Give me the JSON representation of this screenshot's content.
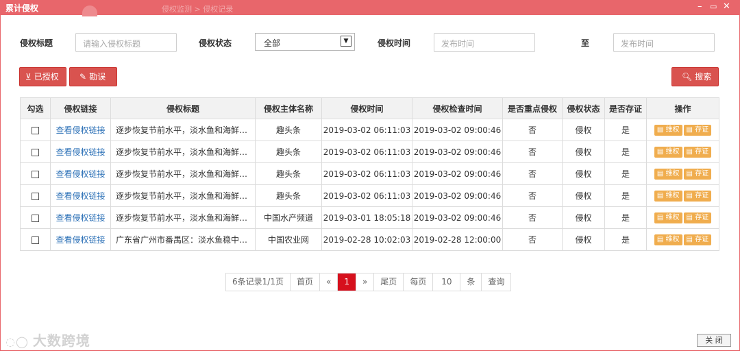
{
  "window": {
    "title": "累计侵权",
    "background_crumb": "侵权监测 > 侵权记录",
    "controls": {
      "minimize": "–",
      "maximize": "▭",
      "close": "✕"
    }
  },
  "filters": {
    "title_label": "侵权标题",
    "title_placeholder": "请输入侵权标题",
    "status_label": "侵权状态",
    "status_value": "全部",
    "time_label": "侵权时间",
    "time_from_placeholder": "发布时间",
    "to_label": "至",
    "time_to_placeholder": "发布时间"
  },
  "actions": {
    "authorized": "已授权",
    "misreport": "勘误",
    "search": "搜索"
  },
  "table": {
    "headers": [
      "勾选",
      "侵权链接",
      "侵权标题",
      "侵权主体名称",
      "侵权时间",
      "侵权检查时间",
      "是否重点侵权",
      "侵权状态",
      "是否存证",
      "操作"
    ],
    "rows": [
      {
        "link": "查看侵权链接",
        "title": "逐步恢复节前水平，淡水鱼和海鲜稳...",
        "subject": "趣头条",
        "time": "2019-03-02 06:11:03",
        "check_time": "2019-03-02 09:00:46",
        "key": "否",
        "status": "侵权",
        "evidence": "是"
      },
      {
        "link": "查看侵权链接",
        "title": "逐步恢复节前水平，淡水鱼和海鲜稳...",
        "subject": "趣头条",
        "time": "2019-03-02 06:11:03",
        "check_time": "2019-03-02 09:00:46",
        "key": "否",
        "status": "侵权",
        "evidence": "是"
      },
      {
        "link": "查看侵权链接",
        "title": "逐步恢复节前水平，淡水鱼和海鲜稳...",
        "subject": "趣头条",
        "time": "2019-03-02 06:11:03",
        "check_time": "2019-03-02 09:00:46",
        "key": "否",
        "status": "侵权",
        "evidence": "是"
      },
      {
        "link": "查看侵权链接",
        "title": "逐步恢复节前水平，淡水鱼和海鲜稳...",
        "subject": "趣头条",
        "time": "2019-03-02 06:11:03",
        "check_time": "2019-03-02 09:00:46",
        "key": "否",
        "status": "侵权",
        "evidence": "是"
      },
      {
        "link": "查看侵权链接",
        "title": "逐步恢复节前水平，淡水鱼和海鲜稳...",
        "subject": "中国水产频道",
        "time": "2019-03-01 18:05:18",
        "check_time": "2019-03-02 09:00:46",
        "key": "否",
        "status": "侵权",
        "evidence": "是"
      },
      {
        "link": "查看侵权链接",
        "title": "广东省广州市番禺区：淡水鱼稳中有...",
        "subject": "中国农业网",
        "time": "2019-02-28 10:02:03",
        "check_time": "2019-02-28 12:00:00",
        "key": "否",
        "status": "侵权",
        "evidence": "是"
      }
    ],
    "op_protect": "维权",
    "op_evidence": "存证"
  },
  "pagination": {
    "summary": "6条记录1/1页",
    "first": "首页",
    "prev": "«",
    "current": "1",
    "next": "»",
    "last": "尾页",
    "per_page_label": "每页",
    "per_page_value": "10",
    "unit": "条",
    "query": "查询"
  },
  "footer": {
    "watermark": "大数跨境",
    "close": "关 闭"
  },
  "colors": {
    "accent": "#e8666b",
    "danger": "#d9534f",
    "warning": "#f0ad4e",
    "link": "#2a6fb6",
    "page_active": "#d6101d"
  }
}
